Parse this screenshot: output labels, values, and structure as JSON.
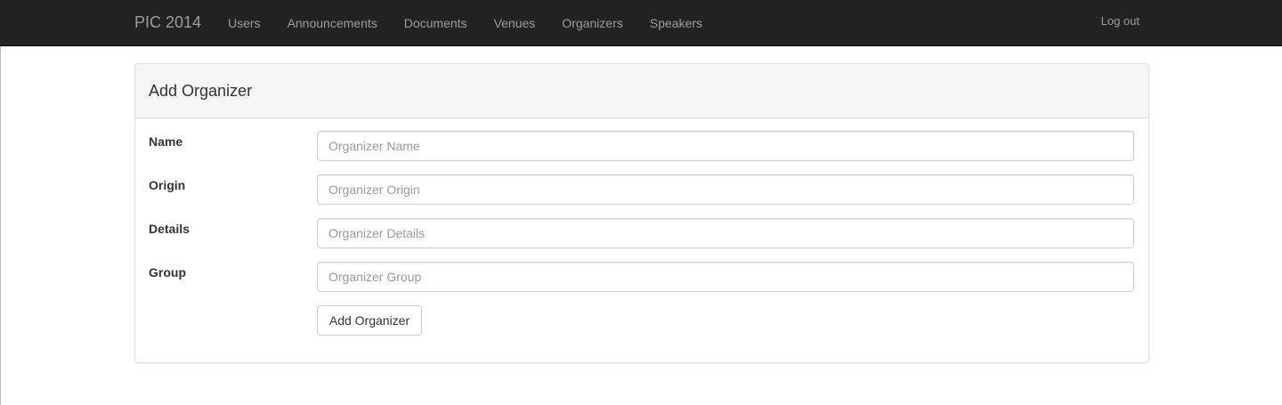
{
  "navbar": {
    "brand": "PIC 2014",
    "links": [
      "Users",
      "Announcements",
      "Documents",
      "Venues",
      "Organizers",
      "Speakers"
    ],
    "logout": "Log out",
    "background": "#222222",
    "link_color": "#9d9d9d"
  },
  "panel": {
    "title": "Add Organizer",
    "fields": [
      {
        "label": "Name",
        "placeholder": "Organizer Name",
        "value": ""
      },
      {
        "label": "Origin",
        "placeholder": "Organizer Origin",
        "value": ""
      },
      {
        "label": "Details",
        "placeholder": "Organizer Details",
        "value": ""
      },
      {
        "label": "Group",
        "placeholder": "Organizer Group",
        "value": ""
      }
    ],
    "submit_label": "Add Organizer"
  }
}
